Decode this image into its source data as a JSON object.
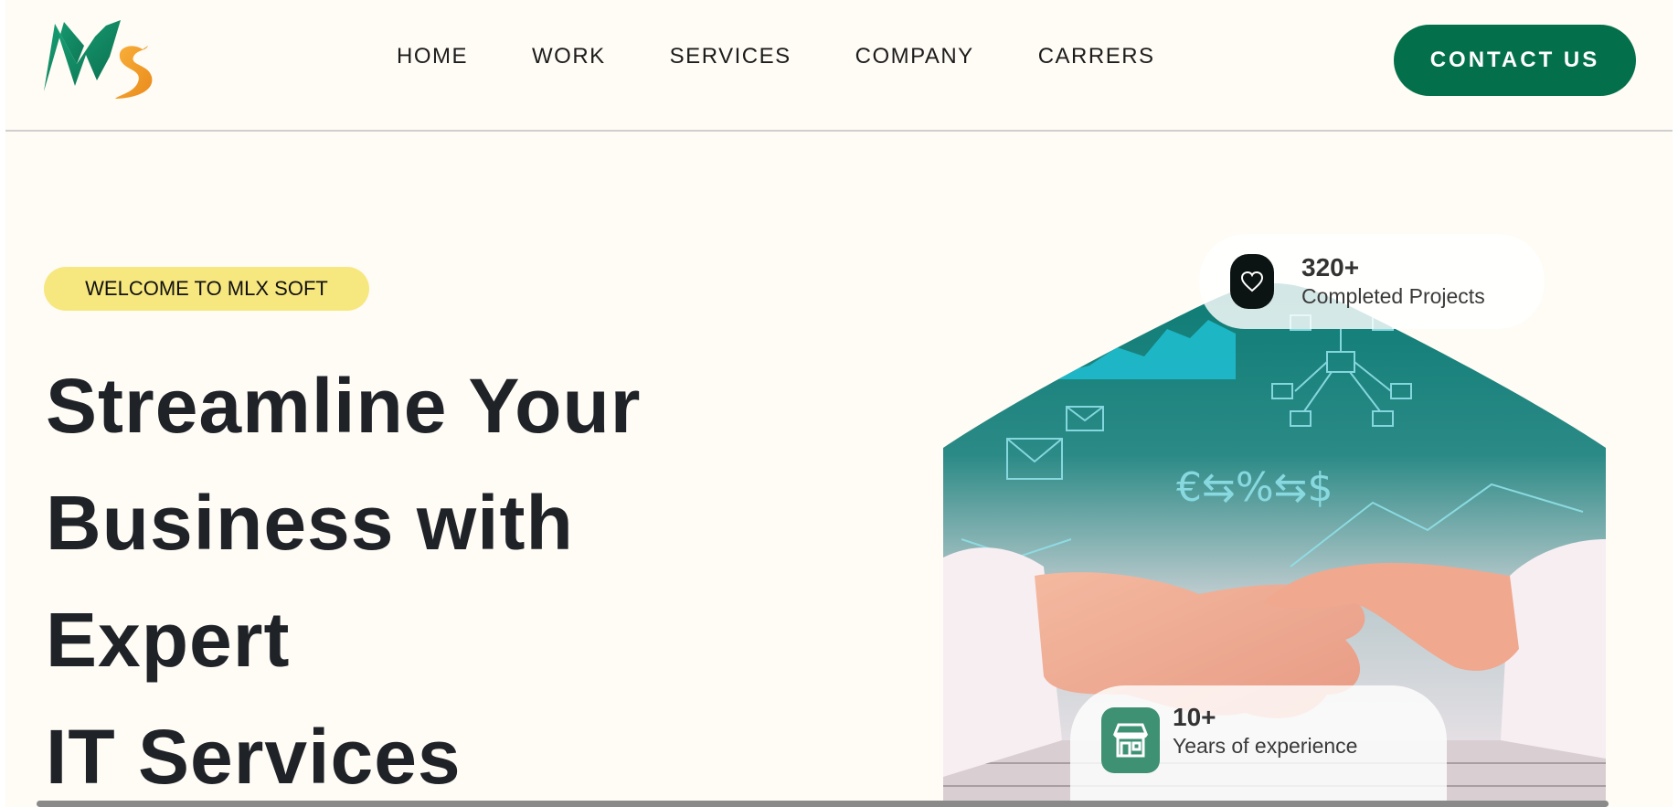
{
  "header": {
    "nav": [
      "HOME",
      "WORK",
      "SERVICES",
      "COMPANY",
      "CARRERS"
    ],
    "contact_label": "CONTACT US"
  },
  "hero": {
    "badge": "WELCOME TO MLX SOFT",
    "headline": [
      "Streamline Your",
      "Business with",
      "Expert",
      "IT Services"
    ]
  },
  "stats": {
    "projects": {
      "value": "320+",
      "label": "Completed Projects",
      "icon": "heart-icon"
    },
    "experience": {
      "value": "10+",
      "label": "Years of experience",
      "icon": "store-icon"
    }
  },
  "colors": {
    "accent": "#04704b",
    "badge_bg": "#f7e77f",
    "page_bg": "#fffbf5"
  }
}
